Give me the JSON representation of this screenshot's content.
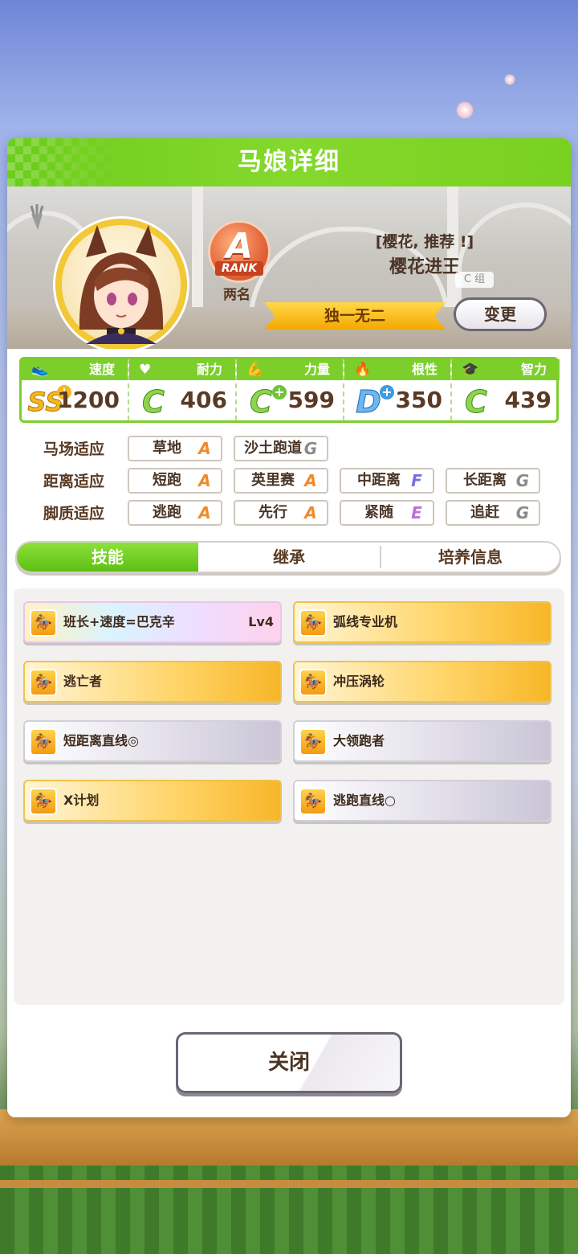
{
  "dialog": {
    "title": "马娘详细"
  },
  "profile": {
    "rank_letter": "A",
    "rank_word": "RANK",
    "rank_name": "两名",
    "epithet": "[樱花, 推荐 !]",
    "name": "樱花进王",
    "variant_tag": "C 组",
    "unique_label": "独一无二",
    "change_button": "变更"
  },
  "stats": [
    {
      "label": "速度",
      "icon": "shoe-icon",
      "grade": "SS",
      "plus": true,
      "value": "1200",
      "color": "#e9a51c"
    },
    {
      "label": "耐力",
      "icon": "heart-icon",
      "grade": "C",
      "plus": false,
      "value": "406",
      "color": "#6cc43a"
    },
    {
      "label": "力量",
      "icon": "muscle-icon",
      "grade": "C",
      "plus": true,
      "value": "599",
      "color": "#6cc43a"
    },
    {
      "label": "根性",
      "icon": "flame-icon",
      "grade": "D",
      "plus": true,
      "value": "350",
      "color": "#3d9be3"
    },
    {
      "label": "智力",
      "icon": "graduation-cap-icon",
      "grade": "C",
      "plus": false,
      "value": "439",
      "color": "#6cc43a"
    }
  ],
  "aptitude": {
    "track": {
      "label": "马场适应",
      "items": [
        {
          "name": "草地",
          "grade": "A"
        },
        {
          "name": "沙土跑道",
          "grade": "G"
        }
      ]
    },
    "distance": {
      "label": "距离适应",
      "items": [
        {
          "name": "短跑",
          "grade": "A"
        },
        {
          "name": "英里赛",
          "grade": "A"
        },
        {
          "name": "中距离",
          "grade": "F"
        },
        {
          "name": "长距离",
          "grade": "G"
        }
      ]
    },
    "strategy": {
      "label": "脚质适应",
      "items": [
        {
          "name": "逃跑",
          "grade": "A"
        },
        {
          "name": "先行",
          "grade": "A"
        },
        {
          "name": "紧随",
          "grade": "E"
        },
        {
          "name": "追赶",
          "grade": "G"
        }
      ]
    }
  },
  "tabs": [
    {
      "label": "技能",
      "active": true
    },
    {
      "label": "继承",
      "active": false
    },
    {
      "label": "培养信息",
      "active": false
    }
  ],
  "skills": [
    {
      "name": "班长+速度=巴克辛",
      "level": "Lv4",
      "style": "rainbow"
    },
    {
      "name": "弧线专业机",
      "level": "",
      "style": "gold"
    },
    {
      "name": "逃亡者",
      "level": "",
      "style": "gold"
    },
    {
      "name": "冲压涡轮",
      "level": "",
      "style": "gold"
    },
    {
      "name": "短距离直线◎",
      "level": "",
      "style": "white"
    },
    {
      "name": "大领跑者",
      "level": "",
      "style": "white"
    },
    {
      "name": "X计划",
      "level": "",
      "style": "gold"
    },
    {
      "name": "逃跑直线○",
      "level": "",
      "style": "white"
    }
  ],
  "footer": {
    "close_button": "关闭"
  },
  "colors": {
    "header_green": "#7ccf2a",
    "grade_A": "#f08a2c",
    "grade_G": "#8a8a8a",
    "grade_F": "#7a6ee0",
    "grade_E": "#c06ed8"
  }
}
